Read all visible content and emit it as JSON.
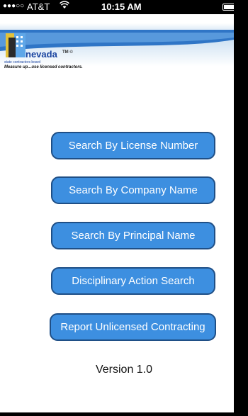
{
  "status_bar": {
    "signal_dots": "●●●○○",
    "carrier": "AT&T",
    "wifi_icon": "wifi-icon",
    "time": "10:15 AM",
    "battery_level": 0.85
  },
  "header": {
    "brand": "nevada",
    "trademark": "TM ©",
    "subtitle": "state contractors board",
    "tagline": "Measure up...use licensed contractors."
  },
  "buttons": [
    {
      "label": "Search By License Number"
    },
    {
      "label": "Search By Company Name"
    },
    {
      "label": "Search By Principal Name"
    },
    {
      "label": "Disciplinary Action Search"
    },
    {
      "label": "Report Unlicensed Contracting"
    }
  ],
  "footer": {
    "version": "Version 1.0"
  },
  "colors": {
    "button_fill": "#3d8fe0",
    "button_border": "#1f4f86",
    "brand_blue": "#1a44a0"
  }
}
